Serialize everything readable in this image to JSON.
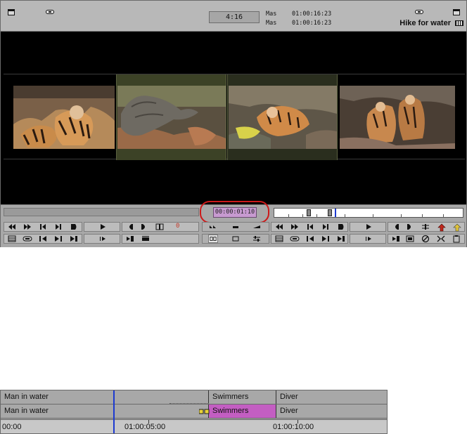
{
  "header": {
    "timecode_box": "4:16",
    "mas_label_1": "Mas",
    "mas_value_1": "01:00:16:23",
    "mas_label_2": "Mas",
    "mas_value_2": "01:00:16:23",
    "sequence_name": "Hike for water"
  },
  "controls": {
    "center_timecode": "00:00:01:10",
    "mark_number": "0"
  },
  "timeline": {
    "tracks": [
      {
        "segments": [
          "Man in water",
          "",
          "Swimmers",
          "Diver"
        ]
      },
      {
        "segments": [
          "Man in water",
          "",
          "Swimmers",
          "Diver"
        ]
      }
    ],
    "timecodes": [
      "00:00",
      "01:00:05:00",
      "01:00:10:00"
    ]
  },
  "colors": {
    "accent_purple": "#c79ad0",
    "segment_pink": "#c35ec2",
    "highlight_ring": "#cc1a1a",
    "playhead": "#1d3ad0"
  }
}
